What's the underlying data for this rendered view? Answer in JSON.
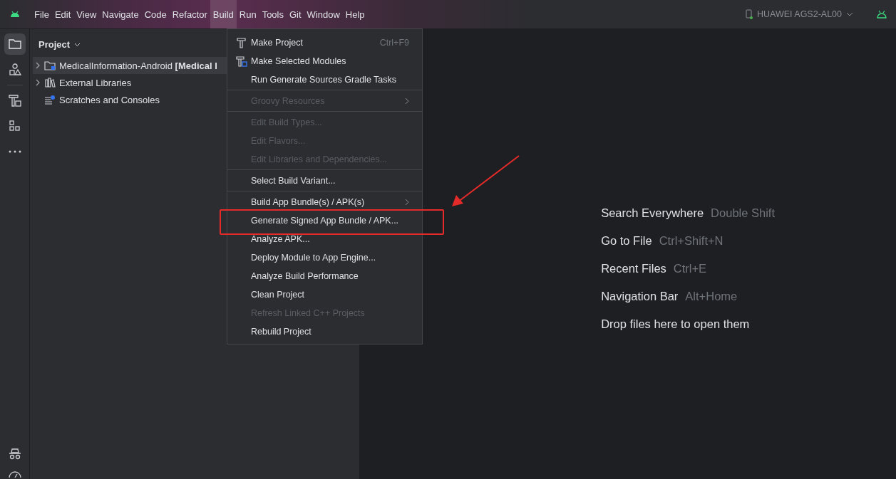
{
  "menu_bar": [
    {
      "label": "File",
      "selected": false
    },
    {
      "label": "Edit",
      "selected": false
    },
    {
      "label": "View",
      "selected": false
    },
    {
      "label": "Navigate",
      "selected": false
    },
    {
      "label": "Code",
      "selected": false
    },
    {
      "label": "Refactor",
      "selected": false
    },
    {
      "label": "Build",
      "selected": true
    },
    {
      "label": "Run",
      "selected": false
    },
    {
      "label": "Tools",
      "selected": false
    },
    {
      "label": "Git",
      "selected": false
    },
    {
      "label": "Window",
      "selected": false
    },
    {
      "label": "Help",
      "selected": false
    }
  ],
  "device": {
    "label": "HUAWEI AGS2-AL00"
  },
  "project_panel": {
    "title": "Project",
    "tree": [
      {
        "label": "MedicalInformation-Android **[Medical I**",
        "expandable": true,
        "selected": true
      },
      {
        "label": "External Libraries",
        "expandable": true,
        "selected": false
      },
      {
        "label": "Scratches and Consoles",
        "expandable": false,
        "selected": false
      }
    ]
  },
  "build_menu": [
    {
      "kind": "item",
      "label": "Make Project",
      "shortcut": "Ctrl+F9",
      "disabled": false,
      "submenu": false,
      "annotated": false
    },
    {
      "kind": "item",
      "label": "Make Selected Modules",
      "disabled": false,
      "submenu": false,
      "annotated": false
    },
    {
      "kind": "item",
      "label": "Run Generate Sources Gradle Tasks",
      "disabled": false,
      "submenu": false,
      "annotated": false
    },
    {
      "kind": "separator"
    },
    {
      "kind": "item",
      "label": "Groovy Resources",
      "disabled": true,
      "submenu": true,
      "annotated": false
    },
    {
      "kind": "separator"
    },
    {
      "kind": "item",
      "label": "Edit Build Types...",
      "disabled": true,
      "submenu": false,
      "annotated": false
    },
    {
      "kind": "item",
      "label": "Edit Flavors...",
      "disabled": true,
      "submenu": false,
      "annotated": false
    },
    {
      "kind": "item",
      "label": "Edit Libraries and Dependencies...",
      "disabled": true,
      "submenu": false,
      "annotated": false
    },
    {
      "kind": "separator"
    },
    {
      "kind": "item",
      "label": "Select Build Variant...",
      "disabled": false,
      "submenu": false,
      "annotated": false
    },
    {
      "kind": "separator"
    },
    {
      "kind": "item",
      "label": "Build App Bundle(s) / APK(s)",
      "disabled": false,
      "submenu": true,
      "annotated": false
    },
    {
      "kind": "item",
      "label": "Generate Signed App Bundle / APK...",
      "disabled": false,
      "submenu": false,
      "annotated": true
    },
    {
      "kind": "item",
      "label": "Analyze APK...",
      "disabled": false,
      "submenu": false,
      "annotated": false
    },
    {
      "kind": "item",
      "label": "Deploy Module to App Engine...",
      "disabled": false,
      "submenu": false,
      "annotated": false
    },
    {
      "kind": "item",
      "label": "Analyze Build Performance",
      "disabled": false,
      "submenu": false,
      "annotated": false
    },
    {
      "kind": "item",
      "label": "Clean Project",
      "disabled": false,
      "submenu": false,
      "annotated": false
    },
    {
      "kind": "item",
      "label": "Refresh Linked C++ Projects",
      "disabled": true,
      "submenu": false,
      "annotated": false
    },
    {
      "kind": "item",
      "label": "Rebuild Project",
      "disabled": false,
      "submenu": false,
      "annotated": false
    }
  ],
  "editor_hints": [
    {
      "action": "Search Everywhere",
      "shortcut": "Double Shift"
    },
    {
      "action": "Go to File",
      "shortcut": "Ctrl+Shift+N"
    },
    {
      "action": "Recent Files",
      "shortcut": "Ctrl+E"
    },
    {
      "action": "Navigation Bar",
      "shortcut": "Alt+Home"
    },
    {
      "action": "Drop files here to open them"
    }
  ]
}
